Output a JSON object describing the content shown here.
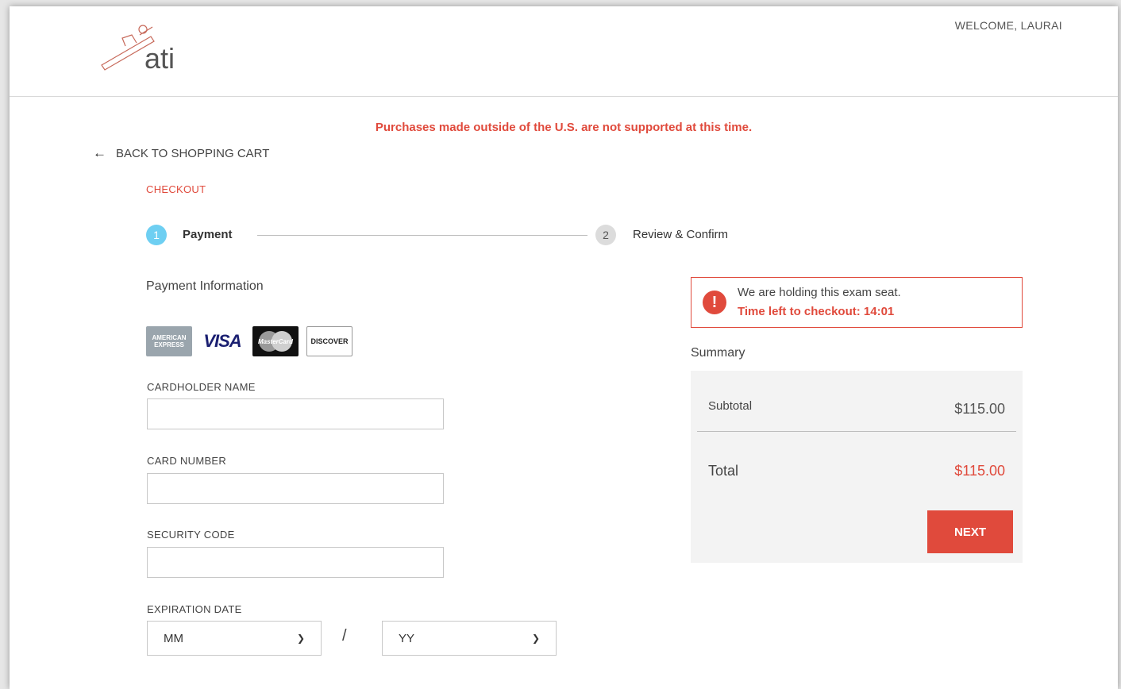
{
  "header": {
    "logo_text": "ati",
    "welcome": "WELCOME, LAURAI"
  },
  "notice": "Purchases made outside of the U.S. are not supported at this time.",
  "nav": {
    "back_label": "BACK TO SHOPPING CART"
  },
  "checkout_label": "CHECKOUT",
  "steps": [
    {
      "number": "1",
      "label": "Payment",
      "active": true
    },
    {
      "number": "2",
      "label": "Review & Confirm",
      "active": false
    }
  ],
  "payment": {
    "section_title": "Payment Information",
    "cards": [
      {
        "name": "amex-icon",
        "line1": "AMERICAN",
        "line2": "EXPRESS"
      },
      {
        "name": "visa-icon",
        "text": "VISA"
      },
      {
        "name": "mastercard-icon",
        "text": "MasterCard"
      },
      {
        "name": "discover-icon",
        "text": "DISCOVER"
      }
    ],
    "fields": {
      "cardholder_label": "CARDHOLDER NAME",
      "cardholder_value": "",
      "card_number_label": "CARD NUMBER",
      "card_number_value": "",
      "security_code_label": "SECURITY CODE",
      "security_code_value": "",
      "expiration_label": "EXPIRATION DATE",
      "month_selected": "MM",
      "year_selected": "YY",
      "separator": "/"
    }
  },
  "timer": {
    "icon": "!",
    "message": "We are holding this exam seat.",
    "countdown": "Time left to checkout: 14:01"
  },
  "summary": {
    "title": "Summary",
    "subtotal_label": "Subtotal",
    "subtotal_value": "$115.00",
    "total_label": "Total",
    "total_value": "$115.00",
    "next_label": "NEXT"
  },
  "colors": {
    "accent": "#e04a3c",
    "step_active": "#6ecff2",
    "step_inactive": "#dcdcdc",
    "summary_bg": "#f3f3f3"
  }
}
